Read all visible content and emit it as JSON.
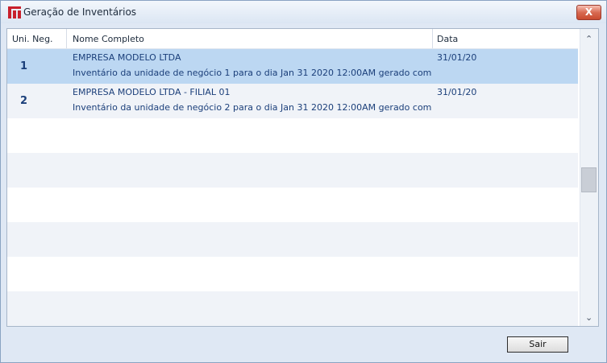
{
  "window": {
    "title": "Geração de Inventários",
    "close_label": "X"
  },
  "table": {
    "headers": [
      "Uni. Neg.",
      "Nome Completo",
      "Data"
    ],
    "rows": [
      {
        "uni": "1",
        "name": "EMPRESA MODELO LTDA",
        "desc": "Inventário da unidade de negócio 1 para o dia Jan 31 2020 12:00AM gerado com",
        "date": "31/01/20"
      },
      {
        "uni": "2",
        "name": "EMPRESA MODELO LTDA - FILIAL 01",
        "desc": "Inventário da unidade de negócio 2 para o dia Jan 31 2020 12:00AM gerado com",
        "date": "31/01/20"
      }
    ]
  },
  "footer": {
    "exit_label": "Sair"
  },
  "icons": {
    "app": "app-logo-icon",
    "up": "chevron-up-icon",
    "down": "chevron-down-icon"
  }
}
